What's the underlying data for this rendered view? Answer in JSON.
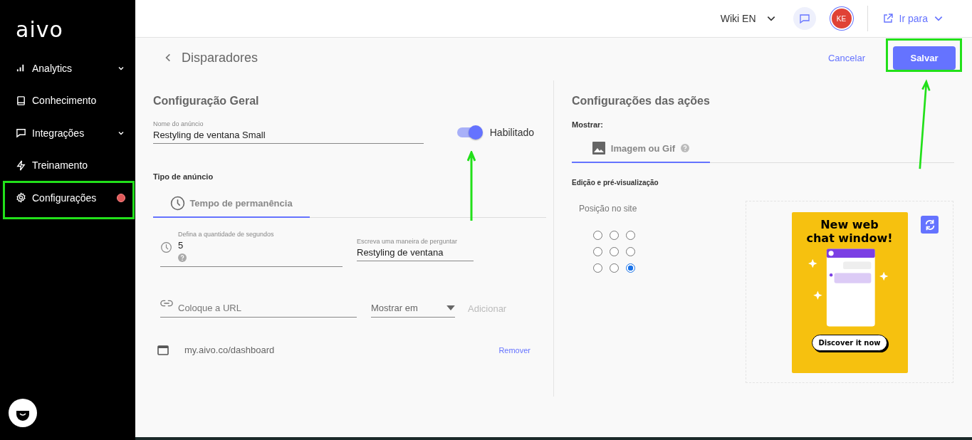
{
  "sidebar": {
    "logo": "aivo",
    "items": [
      {
        "label": "Analytics",
        "expandable": true,
        "alert": false
      },
      {
        "label": "Conhecimento",
        "expandable": false,
        "alert": false
      },
      {
        "label": "Integrações",
        "expandable": true,
        "alert": false
      },
      {
        "label": "Treinamento",
        "expandable": false,
        "alert": false
      },
      {
        "label": "Configurações",
        "expandable": false,
        "alert": true
      }
    ]
  },
  "topbar": {
    "workspace": "Wiki EN",
    "avatar": "KE",
    "goto": "Ir para"
  },
  "page": {
    "title": "Disparadores",
    "cancel": "Cancelar",
    "save": "Salvar"
  },
  "general": {
    "title": "Configuração Geral",
    "name_field": {
      "label": "Nome do anúncio",
      "value": "Restyling de ventana Small"
    },
    "toggle": {
      "label": "Habilitado",
      "on": true
    },
    "type_label": "Tipo de anúncio",
    "tabs": [
      {
        "label": "Tempo de permanência",
        "selected": true
      }
    ],
    "seconds_field": {
      "label": "Defina a quantidade de segundos",
      "value": "5"
    },
    "question_field": {
      "label": "Escreva uma maneira de perguntar",
      "value": "Restyling de ventana"
    },
    "url_field": {
      "placeholder": "Coloque a URL"
    },
    "show_select": {
      "value": "Mostrar em"
    },
    "add_button": {
      "label": "Adicionar",
      "disabled": true
    },
    "urls": [
      {
        "url": "my.aivo.co/dashboard",
        "remove": "Remover"
      }
    ]
  },
  "actions": {
    "title": "Configurações das ações",
    "show_label": "Mostrar:",
    "tabs": [
      {
        "label": "Imagem ou Gif",
        "selected": true
      }
    ],
    "preview_label": "Edição e pré-visualização",
    "position_label": "Posição no site",
    "positions": [
      {
        "selected": false
      },
      {
        "selected": false
      },
      {
        "selected": false
      },
      {
        "selected": false
      },
      {
        "selected": false
      },
      {
        "selected": false
      },
      {
        "selected": false
      },
      {
        "selected": false
      },
      {
        "selected": true
      }
    ],
    "banner": {
      "heading_1": "New web",
      "heading_2": "chat window!",
      "cta": "Discover it now"
    }
  }
}
